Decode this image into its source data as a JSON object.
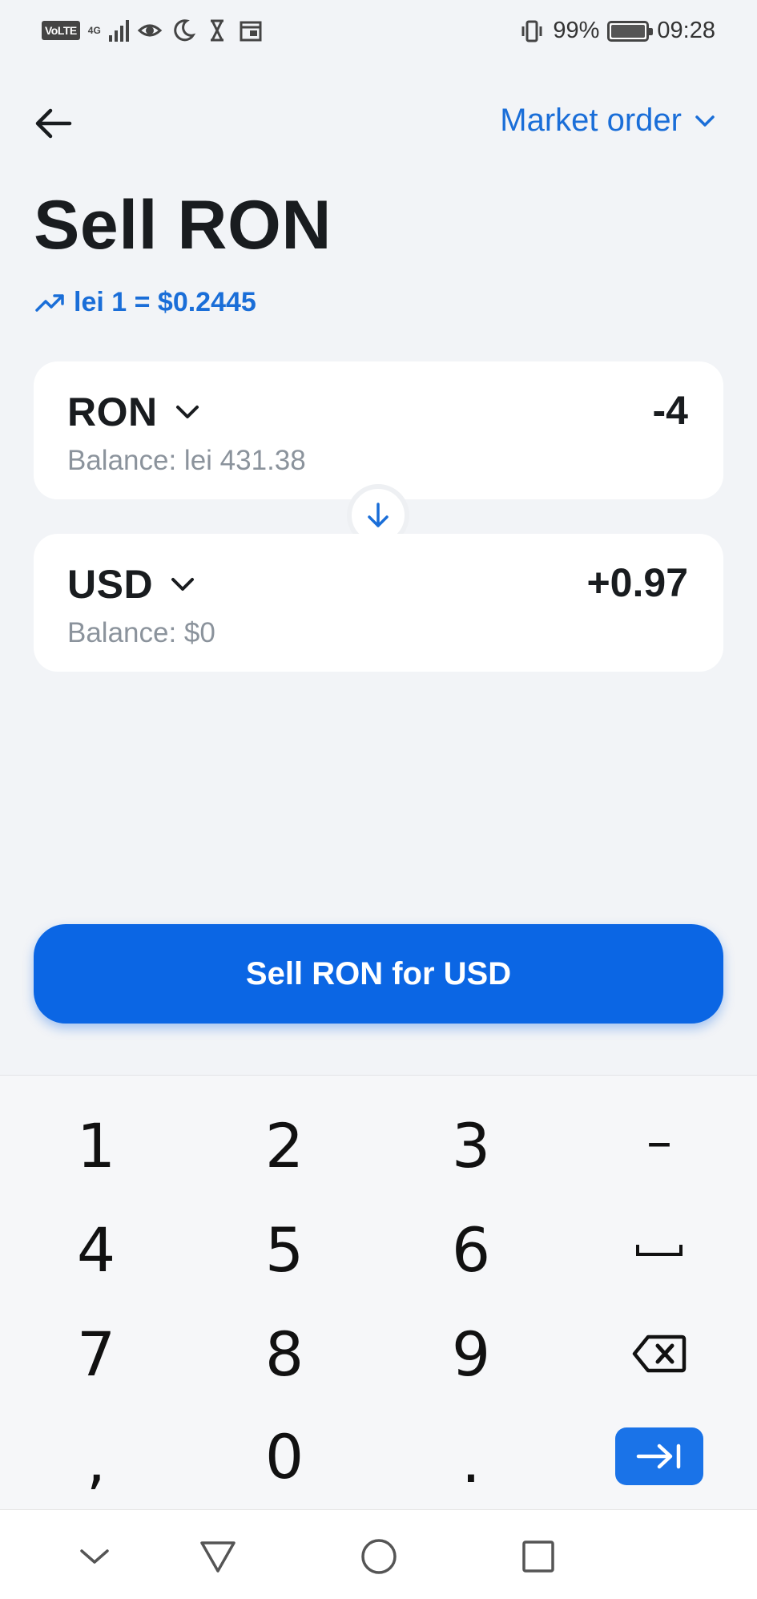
{
  "status_bar": {
    "volte": "VoLTE",
    "network": "4G",
    "battery_percent": "99%",
    "time": "09:28"
  },
  "header": {
    "market_order_label": "Market order",
    "title": "Sell RON",
    "rate": "lei 1 = $0.2445"
  },
  "from": {
    "currency": "RON",
    "amount": "-4",
    "balance": "Balance: lei 431.38"
  },
  "to": {
    "currency": "USD",
    "amount": "+0.97",
    "balance": "Balance: $0"
  },
  "cta_label": "Sell RON for USD",
  "keyboard": {
    "k1": "1",
    "k2": "2",
    "k3": "3",
    "minus": "–",
    "k4": "4",
    "k5": "5",
    "k6": "6",
    "k7": "7",
    "k8": "8",
    "k9": "9",
    "comma": ",",
    "k0": "0",
    "dot": "."
  },
  "colors": {
    "accent": "#0b66e4",
    "link": "#1a6ed8",
    "background": "#f2f4f7"
  }
}
